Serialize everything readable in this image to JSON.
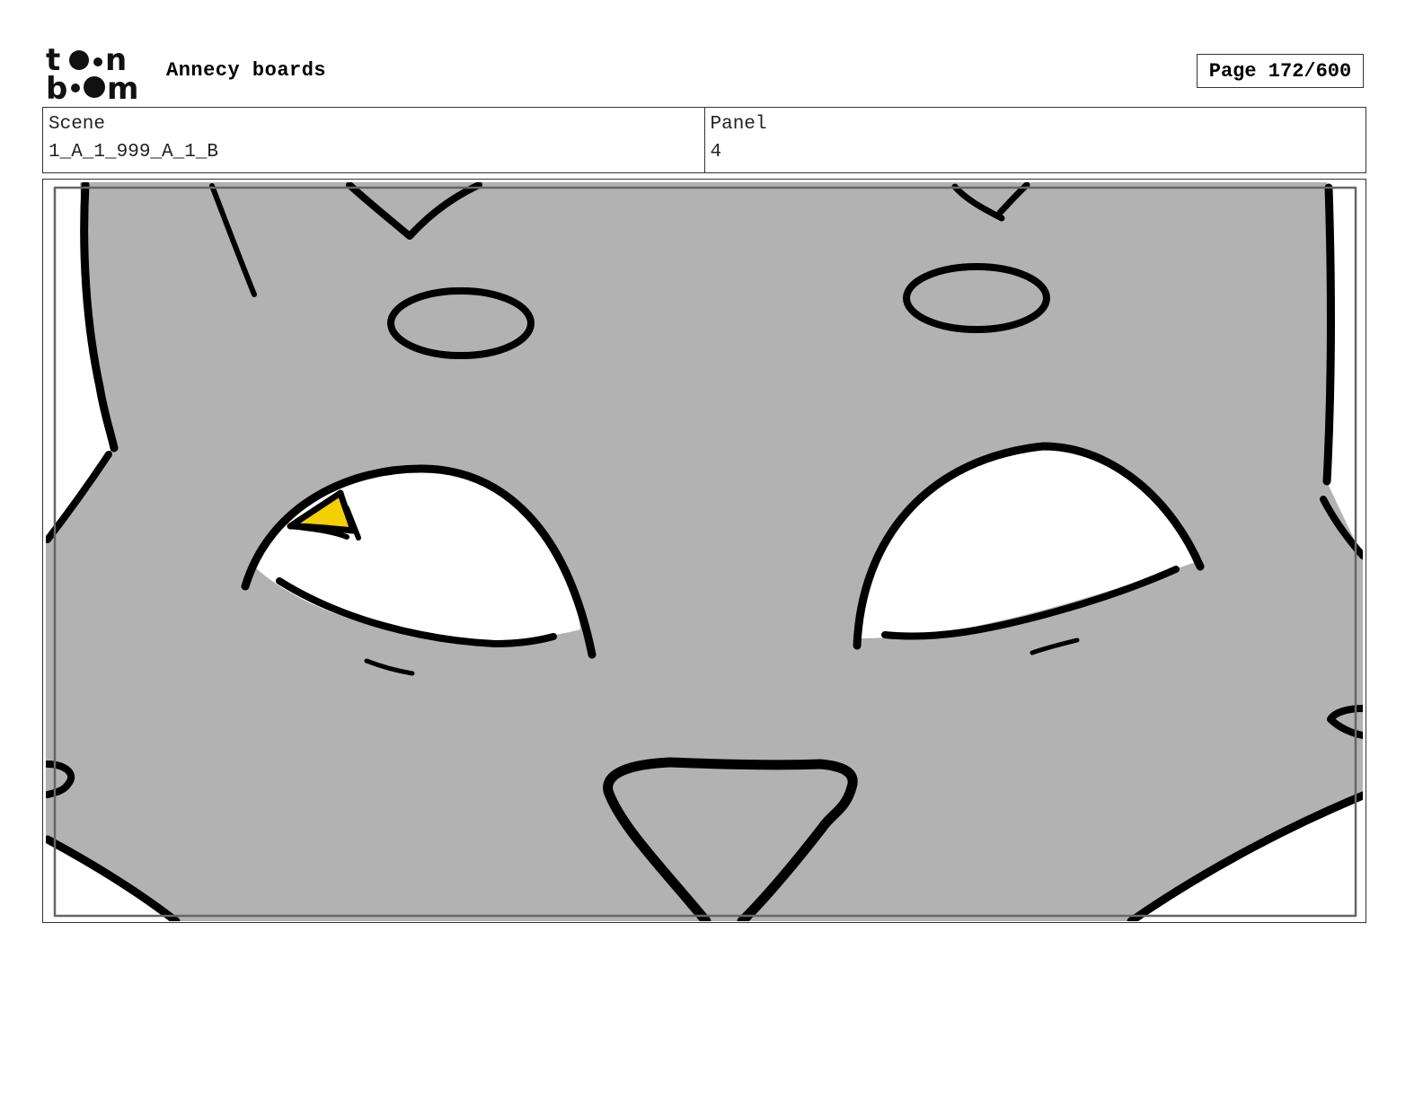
{
  "header": {
    "logo": {
      "icon": "toon-boom-logo",
      "text_top": "toon",
      "text_bottom": "boom"
    },
    "project_title": "Annecy boards",
    "page_label": "Page 172/600"
  },
  "info": {
    "scene_label": "Scene",
    "scene_value": "1_A_1_999_A_1_B",
    "panel_label": "Panel",
    "panel_value": "4"
  },
  "panel": {
    "image": "storyboard-drawing-cat-face-closeup",
    "colors": {
      "fill": "#b2b2b2",
      "line": "#000000",
      "eye": "#ffffff",
      "highlight": "#f5d000"
    }
  }
}
